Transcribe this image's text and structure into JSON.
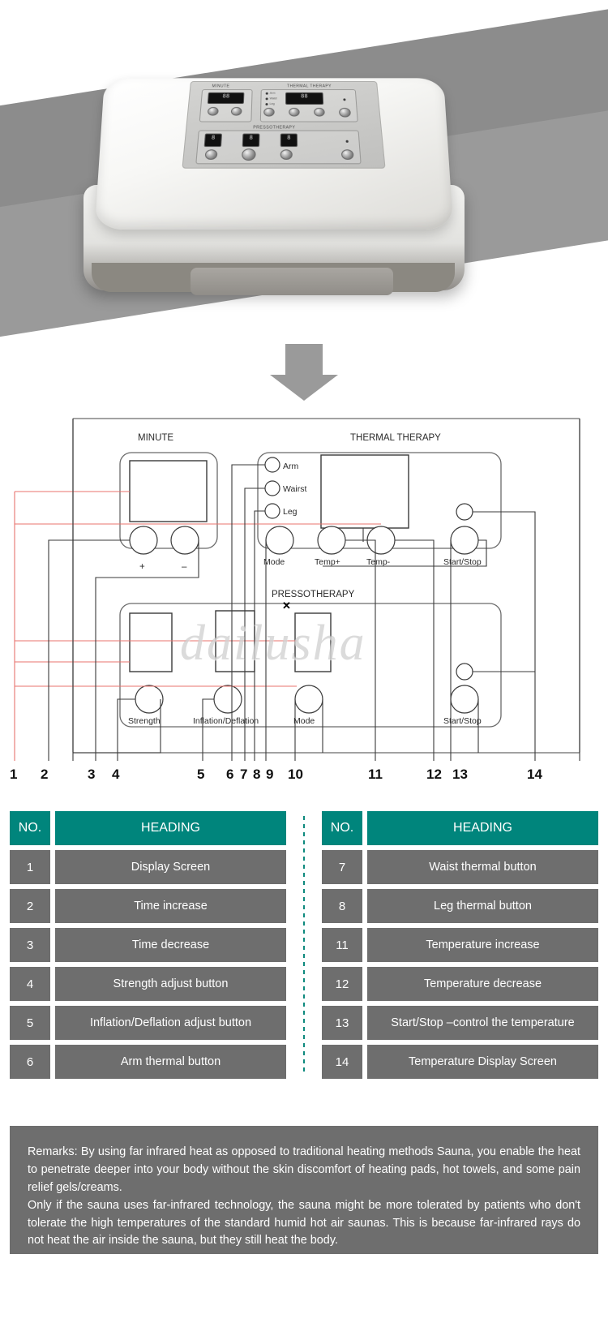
{
  "product_photo": {
    "alt_name": "pressotherapy-thermal-therapy-machine",
    "panel": {
      "minute_title": "MINUTE",
      "thermal_title": "THERMAL THERAPY",
      "presso_title": "PRESSOTHERAPY",
      "minute_display": "88",
      "thermal_display": "88",
      "presso_displays": [
        "8",
        "8",
        "8"
      ],
      "indicator_labels": [
        "Arm",
        "Waist",
        "Leg"
      ],
      "minute_buttons": [
        "+",
        "-"
      ],
      "thermal_buttons": [
        "Mode",
        "Temp+",
        "Temp-",
        "Start/Stop"
      ],
      "presso_buttons": [
        "Strength",
        "Inflation/Deflation",
        "Mode",
        "Start/Stop"
      ]
    }
  },
  "arrow": {
    "direction": "down"
  },
  "diagram": {
    "watermark": "dailusha",
    "sections": {
      "minute": "MINUTE",
      "thermal": "THERMAL THERAPY",
      "presso": "PRESSOTHERAPY"
    },
    "indicators": [
      "Arm",
      "Wairst",
      "Leg"
    ],
    "minute_buttons": [
      "+",
      "–"
    ],
    "thermal_buttons": [
      "Mode",
      "Temp+",
      "Temp-",
      "Start/Stop"
    ],
    "presso_buttons": [
      "Strength",
      "Inflation/Deflation",
      "Mode",
      "Start/Stop"
    ],
    "callout_numbers": [
      "1",
      "2",
      "3",
      "4",
      "5",
      "6",
      "7",
      "8",
      "9",
      "10",
      "11",
      "12",
      "13",
      "14"
    ],
    "x_marker": "✕"
  },
  "tables": {
    "left": {
      "header": {
        "no": "NO.",
        "heading": "HEADING"
      },
      "rows": [
        {
          "no": "1",
          "heading": "Display Screen"
        },
        {
          "no": "2",
          "heading": "Time increase"
        },
        {
          "no": "3",
          "heading": "Time decrease"
        },
        {
          "no": "4",
          "heading": "Strength adjust button"
        },
        {
          "no": "5",
          "heading": "Inflation/Deflation adjust button"
        },
        {
          "no": "6",
          "heading": "Arm thermal button"
        }
      ]
    },
    "right": {
      "header": {
        "no": "NO.",
        "heading": "HEADING"
      },
      "rows": [
        {
          "no": "7",
          "heading": "Waist thermal button"
        },
        {
          "no": "8",
          "heading": "Leg thermal button"
        },
        {
          "no": "11",
          "heading": "Temperature increase"
        },
        {
          "no": "12",
          "heading": "Temperature decrease"
        },
        {
          "no": "13",
          "heading": "Start/Stop –control the temperature"
        },
        {
          "no": "14",
          "heading": "Temperature Display Screen"
        }
      ]
    }
  },
  "remarks": {
    "paragraph1": "Remarks: By using far infrared heat as opposed to traditional heating methods Sauna, you enable the heat to penetrate deeper into your body without the skin discomfort of heating pads, hot towels, and some pain relief gels/creams.",
    "paragraph2": "Only if the sauna uses far-infrared technology, the sauna might be more tolerated by patients who don't tolerate the high temperatures of the standard humid hot air saunas. This is because far-infrared rays do not heat the air inside the sauna, but they still heat the body."
  },
  "colors": {
    "header_teal": "#00857c",
    "row_gray": "#6e6e6e",
    "arrow_gray": "#9a9a9a",
    "callout_red": "#e8736e"
  }
}
